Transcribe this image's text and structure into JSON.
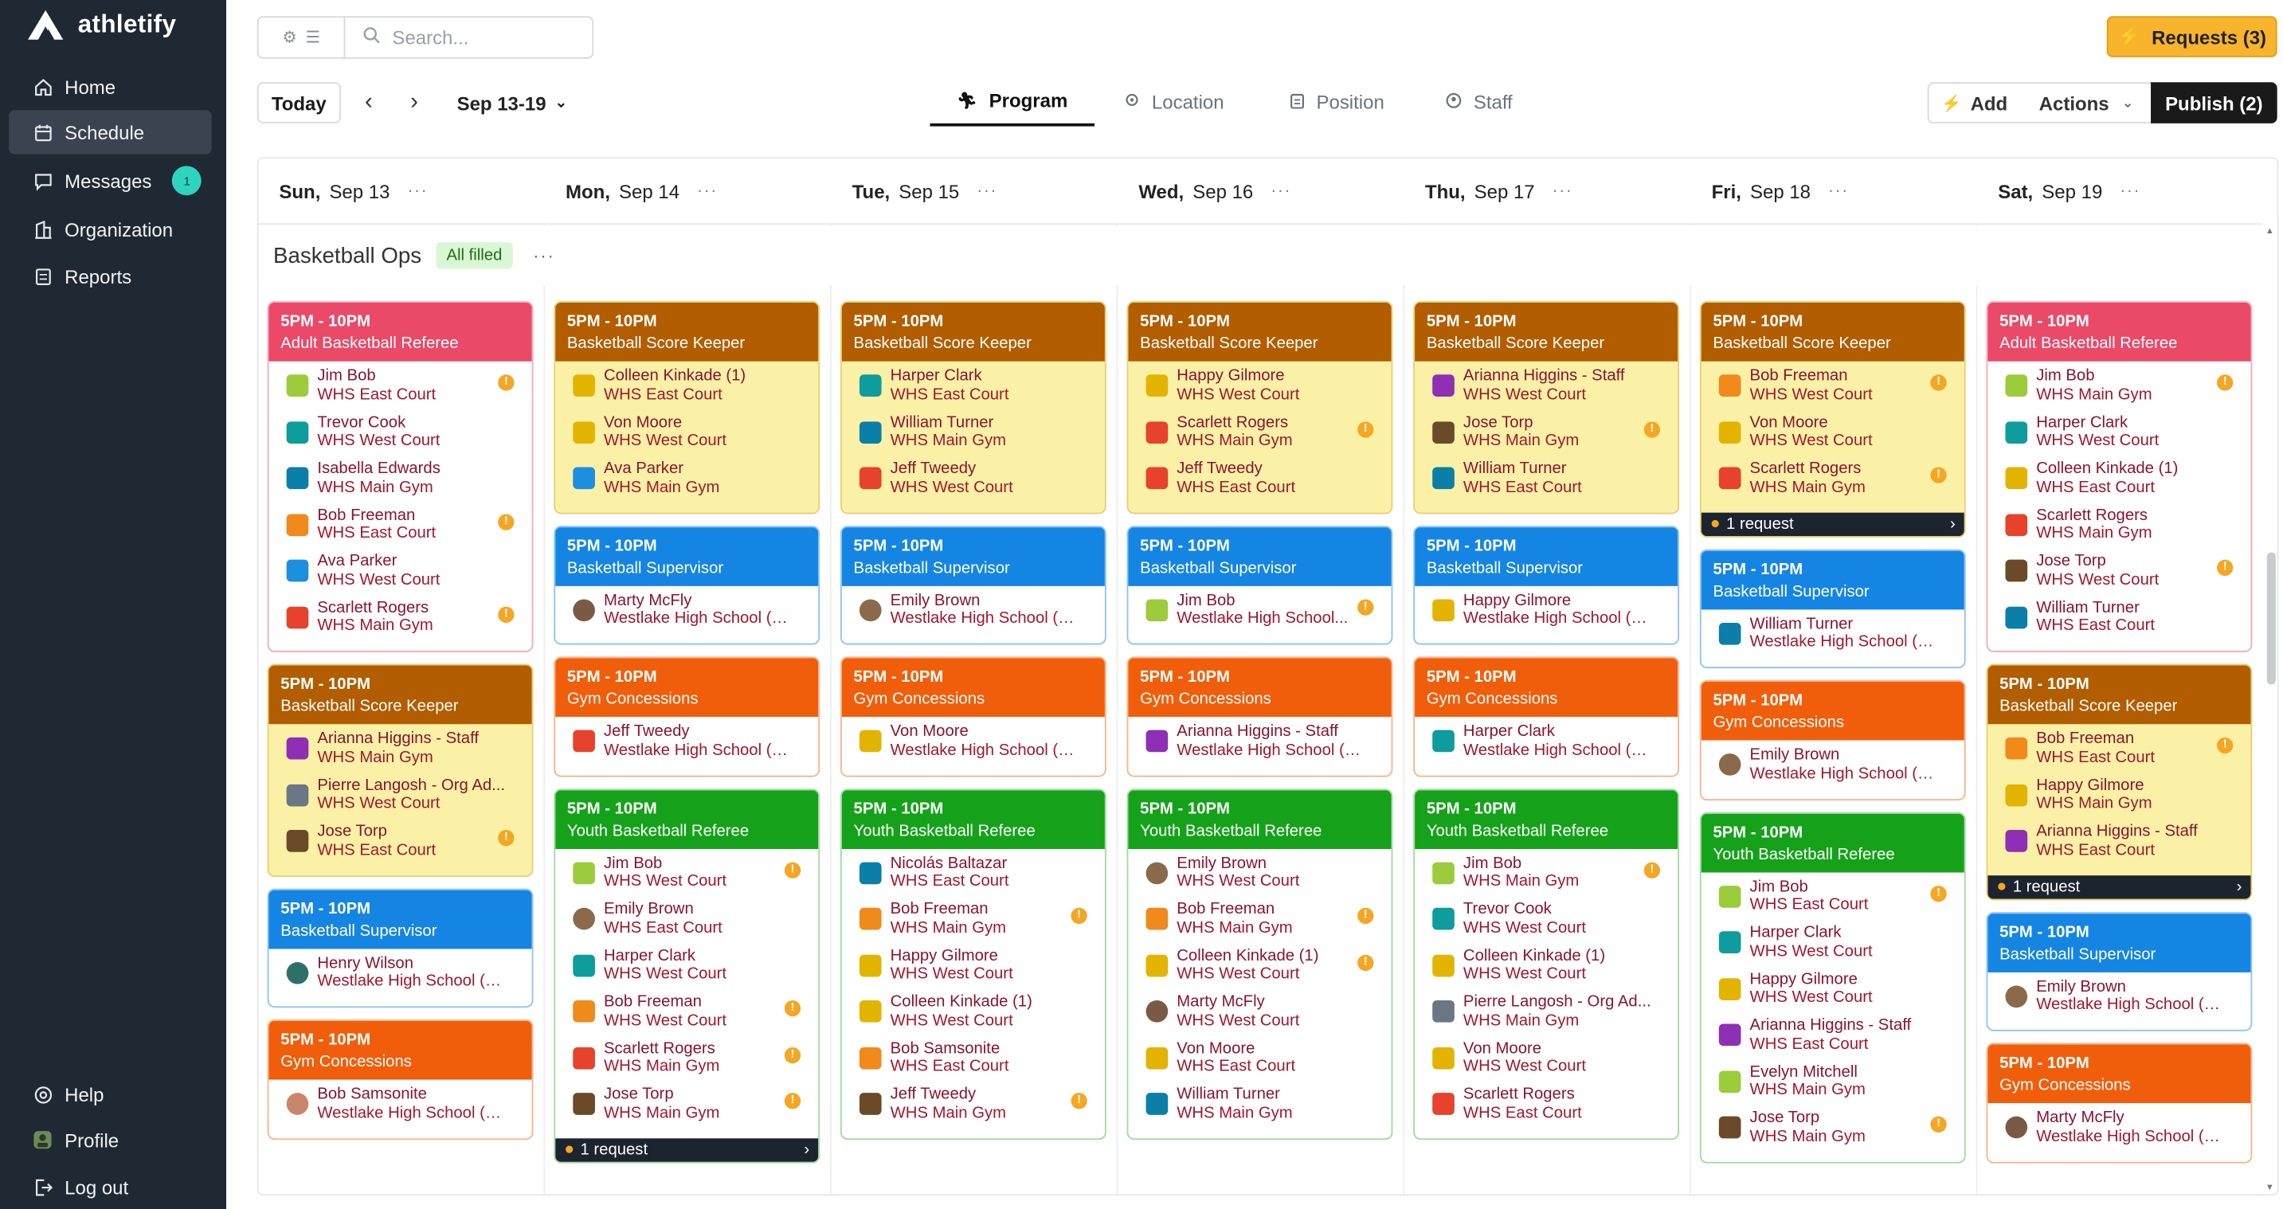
{
  "app": {
    "name": "athletify"
  },
  "nav": {
    "top": [
      {
        "label": "Home",
        "icon": "home-icon"
      },
      {
        "label": "Schedule",
        "icon": "calendar-icon",
        "active": true
      },
      {
        "label": "Messages",
        "icon": "message-icon",
        "badge": "1"
      },
      {
        "label": "Organization",
        "icon": "building-icon"
      },
      {
        "label": "Reports",
        "icon": "report-icon"
      }
    ],
    "bottom": [
      {
        "label": "Help",
        "icon": "help-icon"
      },
      {
        "label": "Profile",
        "icon": "profile-icon"
      },
      {
        "label": "Log out",
        "icon": "logout-icon"
      }
    ]
  },
  "toolbar": {
    "search_placeholder": "Search...",
    "requests_label": "Requests (3)",
    "today_label": "Today",
    "date_range": "Sep 13-19",
    "tabs": [
      {
        "label": "Program",
        "icon": "run-icon",
        "active": true
      },
      {
        "label": "Location",
        "icon": "location-icon"
      },
      {
        "label": "Position",
        "icon": "clipboard-icon"
      },
      {
        "label": "Staff",
        "icon": "staff-icon"
      }
    ],
    "add_label": "Add",
    "actions_label": "Actions",
    "publish_label": "Publish (2)"
  },
  "days": [
    {
      "dow": "Sun,",
      "date": "Sep 13"
    },
    {
      "dow": "Mon,",
      "date": "Sep 14"
    },
    {
      "dow": "Tue,",
      "date": "Sep 15"
    },
    {
      "dow": "Wed,",
      "date": "Sep 16"
    },
    {
      "dow": "Thu,",
      "date": "Sep 17"
    },
    {
      "dow": "Fri,",
      "date": "Sep 18"
    },
    {
      "dow": "Sat,",
      "date": "Sep 19"
    }
  ],
  "section": {
    "title": "Basketball Ops",
    "status": "All filled"
  },
  "colors": {
    "referee": "#ea4968",
    "scorekeeper": "#b15d00",
    "supervisor": "#1585e3",
    "concessions": "#f15e0b",
    "youth": "#15a21a",
    "sidebar": "#1f2933",
    "requests": "#f7b42c"
  },
  "columns": [
    {
      "cards": [
        {
          "time": "5PM - 10PM",
          "role": "Adult Basketball Referee",
          "color": "red",
          "people": [
            {
              "name": "Jim Bob",
              "loc": "WHS East Court",
              "warn": true,
              "av": "#9ccc3b"
            },
            {
              "name": "Trevor Cook",
              "loc": "WHS West Court",
              "warn": false,
              "av": "#0e9c9c"
            },
            {
              "name": "Isabella Edwards",
              "loc": "WHS Main Gym",
              "warn": false,
              "av": "#0b7fa8"
            },
            {
              "name": "Bob Freeman",
              "loc": "WHS East Court",
              "warn": true,
              "av": "#f08a1a"
            },
            {
              "name": "Ava Parker",
              "loc": "WHS West Court",
              "warn": false,
              "av": "#1d8fe0"
            },
            {
              "name": "Scarlett Rogers",
              "loc": "WHS Main Gym",
              "warn": true,
              "av": "#e7422c"
            }
          ]
        },
        {
          "time": "5PM - 10PM",
          "role": "Basketball Score Keeper",
          "color": "brn",
          "people": [
            {
              "name": "Arianna Higgins - Staff",
              "loc": "WHS Main Gym",
              "warn": false,
              "av": "#8e2fb5"
            },
            {
              "name": "Pierre Langosh - Org Ad...",
              "loc": "WHS West Court",
              "warn": false,
              "av": "#6b7785"
            },
            {
              "name": "Jose Torp",
              "loc": "WHS East Court",
              "warn": true,
              "av": "#6b4a2a"
            }
          ]
        },
        {
          "time": "5PM - 10PM",
          "role": "Basketball Supervisor",
          "color": "blu",
          "people": [
            {
              "name": "Henry Wilson",
              "loc": "Westlake High School (W...",
              "warn": false,
              "av": "#2f6f6a",
              "photo": true
            }
          ]
        },
        {
          "time": "5PM - 10PM",
          "role": "Gym Concessions",
          "color": "org",
          "people": [
            {
              "name": "Bob Samsonite",
              "loc": "Westlake High School (W...",
              "warn": false,
              "av": "#c9866b",
              "photo": true
            }
          ]
        }
      ]
    },
    {
      "cards": [
        {
          "time": "5PM - 10PM",
          "role": "Basketball Score Keeper",
          "color": "brn",
          "people": [
            {
              "name": "Colleen Kinkade (1)",
              "loc": "WHS East Court",
              "warn": false,
              "av": "#e2b400"
            },
            {
              "name": "Von Moore",
              "loc": "WHS West Court",
              "warn": false,
              "av": "#e2b400"
            },
            {
              "name": "Ava Parker",
              "loc": "WHS Main Gym",
              "warn": false,
              "av": "#1d8fe0"
            }
          ]
        },
        {
          "time": "5PM - 10PM",
          "role": "Basketball Supervisor",
          "color": "blu",
          "people": [
            {
              "name": "Marty McFly",
              "loc": "Westlake High School (W...",
              "warn": false,
              "av": "#7a5a44",
              "photo": true
            }
          ]
        },
        {
          "time": "5PM - 10PM",
          "role": "Gym Concessions",
          "color": "org",
          "people": [
            {
              "name": "Jeff Tweedy",
              "loc": "Westlake High School (W...",
              "warn": false,
              "av": "#e7422c"
            }
          ]
        },
        {
          "time": "5PM - 10PM",
          "role": "Youth Basketball Referee",
          "color": "grn",
          "request": "1 request",
          "people": [
            {
              "name": "Jim Bob",
              "loc": "WHS West Court",
              "warn": true,
              "av": "#9ccc3b"
            },
            {
              "name": "Emily Brown",
              "loc": "WHS East Court",
              "warn": false,
              "av": "#8a6a4a",
              "photo": true
            },
            {
              "name": "Harper Clark",
              "loc": "WHS West Court",
              "warn": false,
              "av": "#0e9c9c"
            },
            {
              "name": "Bob Freeman",
              "loc": "WHS West Court",
              "warn": true,
              "av": "#f08a1a"
            },
            {
              "name": "Scarlett Rogers",
              "loc": "WHS Main Gym",
              "warn": true,
              "av": "#e7422c"
            },
            {
              "name": "Jose Torp",
              "loc": "WHS Main Gym",
              "warn": true,
              "av": "#6b4a2a"
            }
          ]
        }
      ]
    },
    {
      "cards": [
        {
          "time": "5PM - 10PM",
          "role": "Basketball Score Keeper",
          "color": "brn",
          "people": [
            {
              "name": "Harper Clark",
              "loc": "WHS East Court",
              "warn": false,
              "av": "#0e9c9c"
            },
            {
              "name": "William Turner",
              "loc": "WHS Main Gym",
              "warn": false,
              "av": "#0b7fa8"
            },
            {
              "name": "Jeff Tweedy",
              "loc": "WHS West Court",
              "warn": false,
              "av": "#e7422c"
            }
          ]
        },
        {
          "time": "5PM - 10PM",
          "role": "Basketball Supervisor",
          "color": "blu",
          "people": [
            {
              "name": "Emily Brown",
              "loc": "Westlake High School (W...",
              "warn": false,
              "av": "#8a6a4a",
              "photo": true
            }
          ]
        },
        {
          "time": "5PM - 10PM",
          "role": "Gym Concessions",
          "color": "org",
          "people": [
            {
              "name": "Von Moore",
              "loc": "Westlake High School (W...",
              "warn": false,
              "av": "#e2b400"
            }
          ]
        },
        {
          "time": "5PM - 10PM",
          "role": "Youth Basketball Referee",
          "color": "grn",
          "people": [
            {
              "name": "Nicolás Baltazar",
              "loc": "WHS East Court",
              "warn": false,
              "av": "#0b7fa8"
            },
            {
              "name": "Bob Freeman",
              "loc": "WHS Main Gym",
              "warn": true,
              "av": "#f08a1a"
            },
            {
              "name": "Happy Gilmore",
              "loc": "WHS West Court",
              "warn": false,
              "av": "#e2b400"
            },
            {
              "name": "Colleen Kinkade (1)",
              "loc": "WHS West Court",
              "warn": false,
              "av": "#e2b400"
            },
            {
              "name": "Bob Samsonite",
              "loc": "WHS East Court",
              "warn": false,
              "av": "#f08a1a"
            },
            {
              "name": "Jeff Tweedy",
              "loc": "WHS Main Gym",
              "warn": true,
              "av": "#6b4a2a"
            }
          ]
        }
      ]
    },
    {
      "cards": [
        {
          "time": "5PM - 10PM",
          "role": "Basketball Score Keeper",
          "color": "brn",
          "people": [
            {
              "name": "Happy Gilmore",
              "loc": "WHS West Court",
              "warn": false,
              "av": "#e2b400"
            },
            {
              "name": "Scarlett Rogers",
              "loc": "WHS Main Gym",
              "warn": true,
              "av": "#e7422c"
            },
            {
              "name": "Jeff Tweedy",
              "loc": "WHS East Court",
              "warn": false,
              "av": "#e7422c"
            }
          ]
        },
        {
          "time": "5PM - 10PM",
          "role": "Basketball Supervisor",
          "color": "blu",
          "people": [
            {
              "name": "Jim Bob",
              "loc": "Westlake High School...",
              "warn": true,
              "av": "#9ccc3b"
            }
          ]
        },
        {
          "time": "5PM - 10PM",
          "role": "Gym Concessions",
          "color": "org",
          "people": [
            {
              "name": "Arianna Higgins - Staff",
              "loc": "Westlake High School (W...",
              "warn": false,
              "av": "#8e2fb5"
            }
          ]
        },
        {
          "time": "5PM - 10PM",
          "role": "Youth Basketball Referee",
          "color": "grn",
          "people": [
            {
              "name": "Emily Brown",
              "loc": "WHS West Court",
              "warn": false,
              "av": "#8a6a4a",
              "photo": true
            },
            {
              "name": "Bob Freeman",
              "loc": "WHS Main Gym",
              "warn": true,
              "av": "#f08a1a"
            },
            {
              "name": "Colleen Kinkade (1)",
              "loc": "WHS West Court",
              "warn": true,
              "av": "#e2b400"
            },
            {
              "name": "Marty McFly",
              "loc": "WHS West Court",
              "warn": false,
              "av": "#7a5a44",
              "photo": true
            },
            {
              "name": "Von Moore",
              "loc": "WHS East Court",
              "warn": false,
              "av": "#e2b400"
            },
            {
              "name": "William Turner",
              "loc": "WHS Main Gym",
              "warn": false,
              "av": "#0b7fa8"
            }
          ]
        }
      ]
    },
    {
      "cards": [
        {
          "time": "5PM - 10PM",
          "role": "Basketball Score Keeper",
          "color": "brn",
          "people": [
            {
              "name": "Arianna Higgins - Staff",
              "loc": "WHS West Court",
              "warn": false,
              "av": "#8e2fb5"
            },
            {
              "name": "Jose Torp",
              "loc": "WHS Main Gym",
              "warn": true,
              "av": "#6b4a2a"
            },
            {
              "name": "William Turner",
              "loc": "WHS East Court",
              "warn": false,
              "av": "#0b7fa8"
            }
          ]
        },
        {
          "time": "5PM - 10PM",
          "role": "Basketball Supervisor",
          "color": "blu",
          "people": [
            {
              "name": "Happy Gilmore",
              "loc": "Westlake High School (W...",
              "warn": false,
              "av": "#e2b400"
            }
          ]
        },
        {
          "time": "5PM - 10PM",
          "role": "Gym Concessions",
          "color": "org",
          "people": [
            {
              "name": "Harper Clark",
              "loc": "Westlake High School (W...",
              "warn": false,
              "av": "#0e9c9c"
            }
          ]
        },
        {
          "time": "5PM - 10PM",
          "role": "Youth Basketball Referee",
          "color": "grn",
          "people": [
            {
              "name": "Jim Bob",
              "loc": "WHS Main Gym",
              "warn": true,
              "av": "#9ccc3b"
            },
            {
              "name": "Trevor Cook",
              "loc": "WHS West Court",
              "warn": false,
              "av": "#0e9c9c"
            },
            {
              "name": "Colleen Kinkade (1)",
              "loc": "WHS West Court",
              "warn": false,
              "av": "#e2b400"
            },
            {
              "name": "Pierre Langosh - Org Ad...",
              "loc": "WHS Main Gym",
              "warn": false,
              "av": "#6b7785"
            },
            {
              "name": "Von Moore",
              "loc": "WHS West Court",
              "warn": false,
              "av": "#e2b400"
            },
            {
              "name": "Scarlett Rogers",
              "loc": "WHS East Court",
              "warn": false,
              "av": "#e7422c"
            }
          ]
        }
      ]
    },
    {
      "cards": [
        {
          "time": "5PM - 10PM",
          "role": "Basketball Score Keeper",
          "color": "brn",
          "request": "1 request",
          "people": [
            {
              "name": "Bob Freeman",
              "loc": "WHS West Court",
              "warn": true,
              "av": "#f08a1a"
            },
            {
              "name": "Von Moore",
              "loc": "WHS West Court",
              "warn": false,
              "av": "#e2b400"
            },
            {
              "name": "Scarlett Rogers",
              "loc": "WHS Main Gym",
              "warn": true,
              "av": "#e7422c"
            }
          ]
        },
        {
          "time": "5PM - 10PM",
          "role": "Basketball Supervisor",
          "color": "blu",
          "people": [
            {
              "name": "William Turner",
              "loc": "Westlake High School (W...",
              "warn": false,
              "av": "#0b7fa8"
            }
          ]
        },
        {
          "time": "5PM - 10PM",
          "role": "Gym Concessions",
          "color": "org",
          "people": [
            {
              "name": "Emily Brown",
              "loc": "Westlake High School (W...",
              "warn": false,
              "av": "#8a6a4a",
              "photo": true
            }
          ]
        },
        {
          "time": "5PM - 10PM",
          "role": "Youth Basketball Referee",
          "color": "grn",
          "people": [
            {
              "name": "Jim Bob",
              "loc": "WHS East Court",
              "warn": true,
              "av": "#9ccc3b"
            },
            {
              "name": "Harper Clark",
              "loc": "WHS West Court",
              "warn": false,
              "av": "#0e9c9c"
            },
            {
              "name": "Happy Gilmore",
              "loc": "WHS West Court",
              "warn": false,
              "av": "#e2b400"
            },
            {
              "name": "Arianna Higgins - Staff",
              "loc": "WHS East Court",
              "warn": false,
              "av": "#8e2fb5"
            },
            {
              "name": "Evelyn Mitchell",
              "loc": "WHS Main Gym",
              "warn": false,
              "av": "#9ccc3b"
            },
            {
              "name": "Jose Torp",
              "loc": "WHS Main Gym",
              "warn": true,
              "av": "#6b4a2a"
            }
          ]
        }
      ]
    },
    {
      "cards": [
        {
          "time": "5PM - 10PM",
          "role": "Adult Basketball Referee",
          "color": "red",
          "people": [
            {
              "name": "Jim Bob",
              "loc": "WHS Main Gym",
              "warn": true,
              "av": "#9ccc3b"
            },
            {
              "name": "Harper Clark",
              "loc": "WHS West Court",
              "warn": false,
              "av": "#0e9c9c"
            },
            {
              "name": "Colleen Kinkade (1)",
              "loc": "WHS East Court",
              "warn": false,
              "av": "#e2b400"
            },
            {
              "name": "Scarlett Rogers",
              "loc": "WHS Main Gym",
              "warn": false,
              "av": "#e7422c"
            },
            {
              "name": "Jose Torp",
              "loc": "WHS West Court",
              "warn": true,
              "av": "#6b4a2a"
            },
            {
              "name": "William Turner",
              "loc": "WHS East Court",
              "warn": false,
              "av": "#0b7fa8"
            }
          ]
        },
        {
          "time": "5PM - 10PM",
          "role": "Basketball Score Keeper",
          "color": "brn",
          "request": "1 request",
          "people": [
            {
              "name": "Bob Freeman",
              "loc": "WHS East Court",
              "warn": true,
              "av": "#f08a1a"
            },
            {
              "name": "Happy Gilmore",
              "loc": "WHS Main Gym",
              "warn": false,
              "av": "#e2b400"
            },
            {
              "name": "Arianna Higgins - Staff",
              "loc": "WHS East Court",
              "warn": false,
              "av": "#8e2fb5"
            }
          ]
        },
        {
          "time": "5PM - 10PM",
          "role": "Basketball Supervisor",
          "color": "blu",
          "people": [
            {
              "name": "Emily Brown",
              "loc": "Westlake High School (W...",
              "warn": false,
              "av": "#8a6a4a",
              "photo": true
            }
          ]
        },
        {
          "time": "5PM - 10PM",
          "role": "Gym Concessions",
          "color": "org",
          "people": [
            {
              "name": "Marty McFly",
              "loc": "Westlake High School (W...",
              "warn": false,
              "av": "#7a5a44",
              "photo": true
            }
          ]
        }
      ]
    }
  ]
}
